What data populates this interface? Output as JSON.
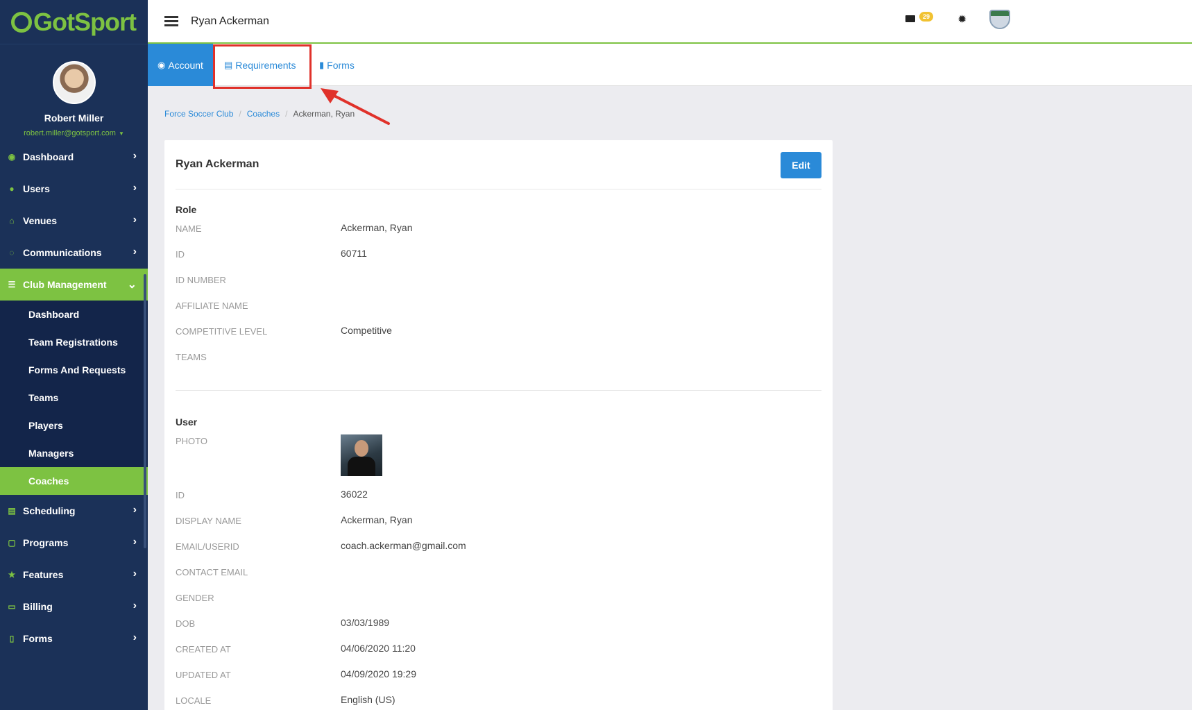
{
  "brand": {
    "name": "GotSport",
    "color": "#7dc242",
    "accent": "#2a8ad8",
    "sidebar_bg": "#1b3158"
  },
  "profile": {
    "name": "Robert Miller",
    "email": "robert.miller@gotsport.com"
  },
  "nav": [
    {
      "label": "Dashboard",
      "icon": "dashboard-icon"
    },
    {
      "label": "Users",
      "icon": "users-icon"
    },
    {
      "label": "Venues",
      "icon": "venues-icon"
    },
    {
      "label": "Communications",
      "icon": "communications-icon"
    },
    {
      "label": "Club Management",
      "icon": "club-management-icon",
      "open": true
    },
    {
      "label": "Scheduling",
      "icon": "scheduling-icon"
    },
    {
      "label": "Programs",
      "icon": "programs-icon"
    },
    {
      "label": "Features",
      "icon": "star-icon"
    },
    {
      "label": "Billing",
      "icon": "billing-icon"
    },
    {
      "label": "Forms",
      "icon": "forms-icon"
    }
  ],
  "club_management_items": [
    {
      "label": "Dashboard"
    },
    {
      "label": "Team Registrations"
    },
    {
      "label": "Forms And Requests"
    },
    {
      "label": "Teams"
    },
    {
      "label": "Players"
    },
    {
      "label": "Managers"
    },
    {
      "label": "Coaches",
      "active": true
    }
  ],
  "topbar": {
    "title": "Ryan Ackerman",
    "mail_count": "29"
  },
  "tabs": [
    {
      "label": "Account",
      "active": true,
      "icon": "user-circle-icon"
    },
    {
      "label": "Requirements",
      "icon": "document-icon"
    },
    {
      "label": "Forms",
      "icon": "file-icon"
    }
  ],
  "breadcrumb": {
    "items": [
      "Force Soccer Club",
      "Coaches"
    ],
    "current": "Ackerman, Ryan"
  },
  "card": {
    "title": "Ryan Ackerman",
    "edit_label": "Edit",
    "role": {
      "title": "Role",
      "rows": [
        {
          "label": "NAME",
          "value": "Ackerman, Ryan"
        },
        {
          "label": "ID",
          "value": "60711"
        },
        {
          "label": "ID NUMBER",
          "value": ""
        },
        {
          "label": "AFFILIATE NAME",
          "value": ""
        },
        {
          "label": "COMPETITIVE LEVEL",
          "value": "Competitive"
        },
        {
          "label": "TEAMS",
          "value": ""
        }
      ]
    },
    "user": {
      "title": "User",
      "photo_label": "PHOTO",
      "rows": [
        {
          "label": "ID",
          "value": "36022"
        },
        {
          "label": "DISPLAY NAME",
          "value": "Ackerman, Ryan"
        },
        {
          "label": "EMAIL/USERID",
          "value": "coach.ackerman@gmail.com"
        },
        {
          "label": "CONTACT EMAIL",
          "value": ""
        },
        {
          "label": "GENDER",
          "value": ""
        },
        {
          "label": "DOB",
          "value": "03/03/1989"
        },
        {
          "label": "CREATED AT",
          "value": "04/06/2020 11:20"
        },
        {
          "label": "UPDATED AT",
          "value": "04/09/2020 19:29"
        },
        {
          "label": "LOCALE",
          "value": "English (US)"
        }
      ]
    }
  }
}
